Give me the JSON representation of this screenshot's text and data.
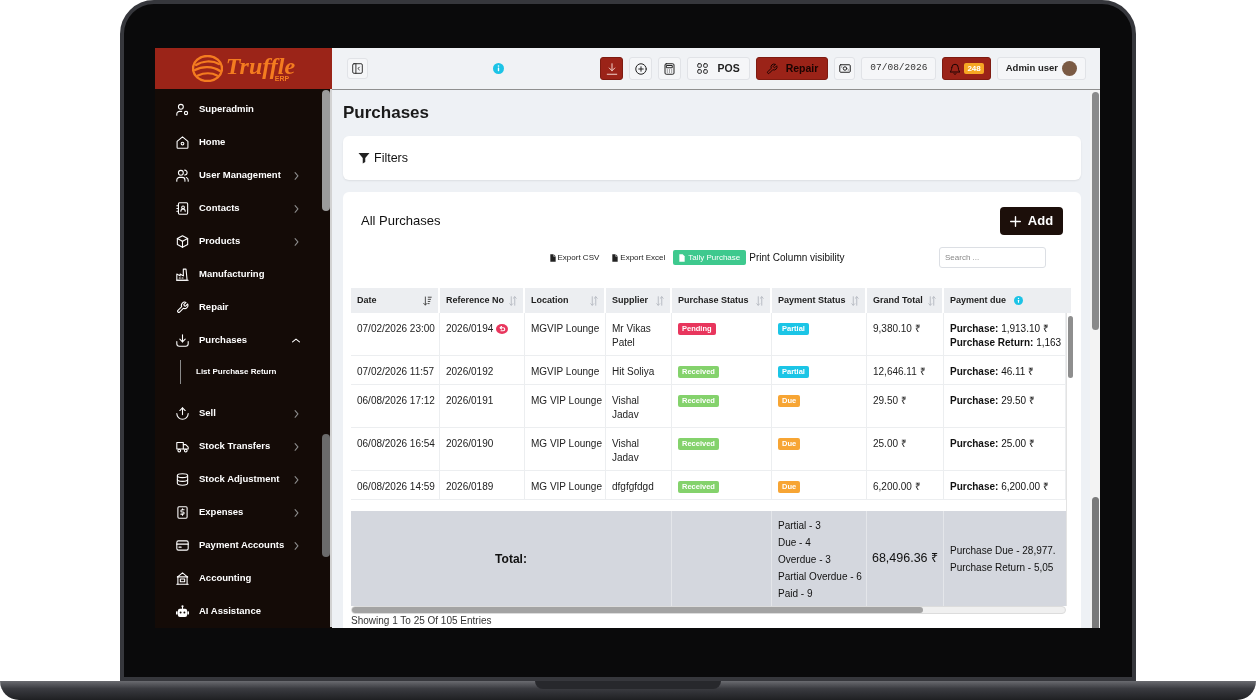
{
  "logo": {
    "text": "Truffle",
    "subtext": "ERP"
  },
  "sidebar": {
    "items": [
      {
        "label": "Superadmin",
        "kind": "link"
      },
      {
        "label": "Home",
        "kind": "link"
      },
      {
        "label": "User Management",
        "kind": "group",
        "expanded": false
      },
      {
        "label": "Contacts",
        "kind": "group",
        "expanded": false
      },
      {
        "label": "Products",
        "kind": "group",
        "expanded": false
      },
      {
        "label": "Manufacturing",
        "kind": "link"
      },
      {
        "label": "Repair",
        "kind": "link"
      },
      {
        "label": "Purchases",
        "kind": "group",
        "expanded": true,
        "children": [
          {
            "label": "List Purchase Return"
          }
        ]
      },
      {
        "label": "Sell",
        "kind": "group",
        "expanded": false
      },
      {
        "label": "Stock Transfers",
        "kind": "group",
        "expanded": false
      },
      {
        "label": "Stock Adjustment",
        "kind": "group",
        "expanded": false
      },
      {
        "label": "Expenses",
        "kind": "group",
        "expanded": false
      },
      {
        "label": "Payment Accounts",
        "kind": "group",
        "expanded": false
      },
      {
        "label": "Accounting",
        "kind": "link"
      },
      {
        "label": "AI Assistance",
        "kind": "link"
      }
    ]
  },
  "topbar": {
    "left": [
      {
        "kind": "sidebar-toggle"
      },
      {
        "kind": "info"
      }
    ],
    "right": [
      {
        "kind": "download"
      },
      {
        "kind": "add"
      },
      {
        "kind": "calculator"
      },
      {
        "kind": "pos",
        "label": "POS"
      },
      {
        "kind": "repair",
        "label": "Repair"
      },
      {
        "kind": "cash"
      },
      {
        "kind": "date",
        "label": "07/08/2026"
      },
      {
        "kind": "notifications",
        "badge": "248"
      },
      {
        "kind": "user",
        "label": "Admin user"
      }
    ]
  },
  "page": {
    "title": "Purchases",
    "filters": {
      "label": "Filters"
    },
    "list_title": "All Purchases",
    "add_button": "Add",
    "actions": [
      {
        "kind": "export",
        "label": "Export CSV"
      },
      {
        "kind": "export",
        "label": "Export Excel"
      },
      {
        "kind": "primary",
        "label": "Tally Purchase"
      },
      {
        "kind": "link",
        "label": "Print"
      },
      {
        "kind": "link",
        "label": "Column visibility"
      }
    ],
    "search": {
      "placeholder": "Search ..."
    },
    "entries_info": "Showing 1 To 25 Of 105 Entries"
  },
  "table": {
    "columns": [
      {
        "label": "Date",
        "kind": "sortable",
        "sorted": true
      },
      {
        "label": "Reference No",
        "kind": "sortable",
        "sorted": false
      },
      {
        "label": "Location",
        "kind": "sortable",
        "sorted": false
      },
      {
        "label": "Supplier",
        "kind": "sortable",
        "sorted": false
      },
      {
        "label": "Purchase Status",
        "kind": "sortable",
        "sorted": false
      },
      {
        "label": "Payment Status",
        "kind": "sortable",
        "sorted": false
      },
      {
        "label": "Grand Total",
        "kind": "sortable",
        "sorted": false
      },
      {
        "label": "Payment due",
        "kind": "info"
      }
    ],
    "rows": [
      {
        "date": "07/02/2026 23:00",
        "reference": "2026/0194",
        "returned": true,
        "location": "MGVIP Lounge",
        "supplier": "Mr Vikas Patel",
        "purchase_status": {
          "label": "Pending",
          "color": "#e8365d"
        },
        "payment_status": {
          "label": "Partial",
          "color": "#1bc5e6"
        },
        "grand_total": "9,380.10 ₹",
        "payment_due": [
          "**Purchase:** 1,913.10 ₹",
          "**Purchase Return:** 1,163"
        ]
      },
      {
        "date": "07/02/2026 11:57",
        "reference": "2026/0192",
        "returned": false,
        "location": "MGVIP Lounge",
        "supplier": "Hit Soliya",
        "purchase_status": {
          "label": "Received",
          "color": "#84d26c"
        },
        "payment_status": {
          "label": "Partial",
          "color": "#1bc5e6"
        },
        "grand_total": "12,646.11 ₹",
        "payment_due": [
          "**Purchase:** 46.11 ₹"
        ]
      },
      {
        "date": "06/08/2026 17:12",
        "reference": "2026/0191",
        "returned": false,
        "location": "MG VIP Lounge",
        "supplier": "Vishal Jadav",
        "purchase_status": {
          "label": "Received",
          "color": "#84d26c"
        },
        "payment_status": {
          "label": "Due",
          "color": "#f7a534"
        },
        "grand_total": "29.50 ₹",
        "payment_due": [
          "**Purchase:** 29.50 ₹"
        ]
      },
      {
        "date": "06/08/2026 16:54",
        "reference": "2026/0190",
        "returned": false,
        "location": "MG VIP Lounge",
        "supplier": "Vishal Jadav",
        "purchase_status": {
          "label": "Received",
          "color": "#84d26c"
        },
        "payment_status": {
          "label": "Due",
          "color": "#f7a534"
        },
        "grand_total": "25.00 ₹",
        "payment_due": [
          "**Purchase:** 25.00 ₹"
        ]
      },
      {
        "date": "06/08/2026 14:59",
        "reference": "2026/0189",
        "returned": false,
        "location": "MG VIP Lounge",
        "supplier": "dfgfgfdgd",
        "purchase_status": {
          "label": "Received",
          "color": "#84d26c"
        },
        "payment_status": {
          "label": "Due",
          "color": "#f7a534"
        },
        "grand_total": "6,200.00 ₹",
        "payment_due": [
          "**Purchase:** 6,200.00 ₹"
        ]
      }
    ],
    "footer": {
      "label": "Total:",
      "payment_status_summary": [
        "Partial - 3",
        "Due - 4",
        "Overdue - 3",
        "Partial Overdue - 6",
        "Paid - 9"
      ],
      "grand_total": "68,496.36 ₹",
      "payment_due_summary": [
        "Purchase Due - 28,977.",
        "Purchase Return - 5,05"
      ]
    }
  }
}
